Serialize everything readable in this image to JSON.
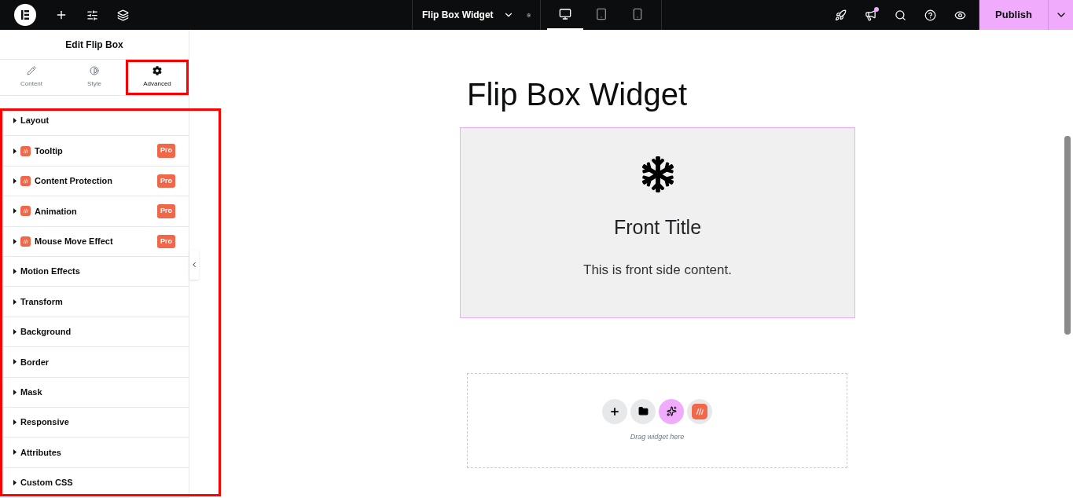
{
  "topbar": {
    "page_title": "Flip Box Widget",
    "devices": [
      {
        "kind": "desktop",
        "selected": true
      },
      {
        "kind": "tablet",
        "selected": false
      },
      {
        "kind": "mobile",
        "selected": false
      }
    ],
    "notification": true,
    "publish": "Publish"
  },
  "panel": {
    "title": "Edit Flip Box",
    "tabs": [
      {
        "label": "Content",
        "kind": "pencil",
        "selected": false,
        "highlighted": false
      },
      {
        "label": "Style",
        "kind": "contrast",
        "selected": false,
        "highlighted": false
      },
      {
        "label": "Advanced",
        "kind": "gear",
        "selected": true,
        "highlighted": true
      }
    ],
    "sections_highlighted": true,
    "sections": [
      {
        "label": "Layout",
        "pro": false
      },
      {
        "label": "Tooltip",
        "pro": true,
        "badge": "Pro"
      },
      {
        "label": "Content Protection",
        "pro": true,
        "badge": "Pro"
      },
      {
        "label": "Animation",
        "pro": true,
        "badge": "Pro"
      },
      {
        "label": "Mouse Move Effect",
        "pro": true,
        "badge": "Pro"
      },
      {
        "label": "Motion Effects",
        "pro": false
      },
      {
        "label": "Transform",
        "pro": false
      },
      {
        "label": "Background",
        "pro": false
      },
      {
        "label": "Border",
        "pro": false
      },
      {
        "label": "Mask",
        "pro": false
      },
      {
        "label": "Responsive",
        "pro": false
      },
      {
        "label": "Attributes",
        "pro": false
      },
      {
        "label": "Custom CSS",
        "pro": false
      }
    ]
  },
  "canvas": {
    "heading": "Flip Box Widget",
    "flip_box": {
      "title": "Front Title",
      "content": "This is front side content."
    },
    "drop_zone": {
      "hint": "Drag widget here"
    }
  }
}
